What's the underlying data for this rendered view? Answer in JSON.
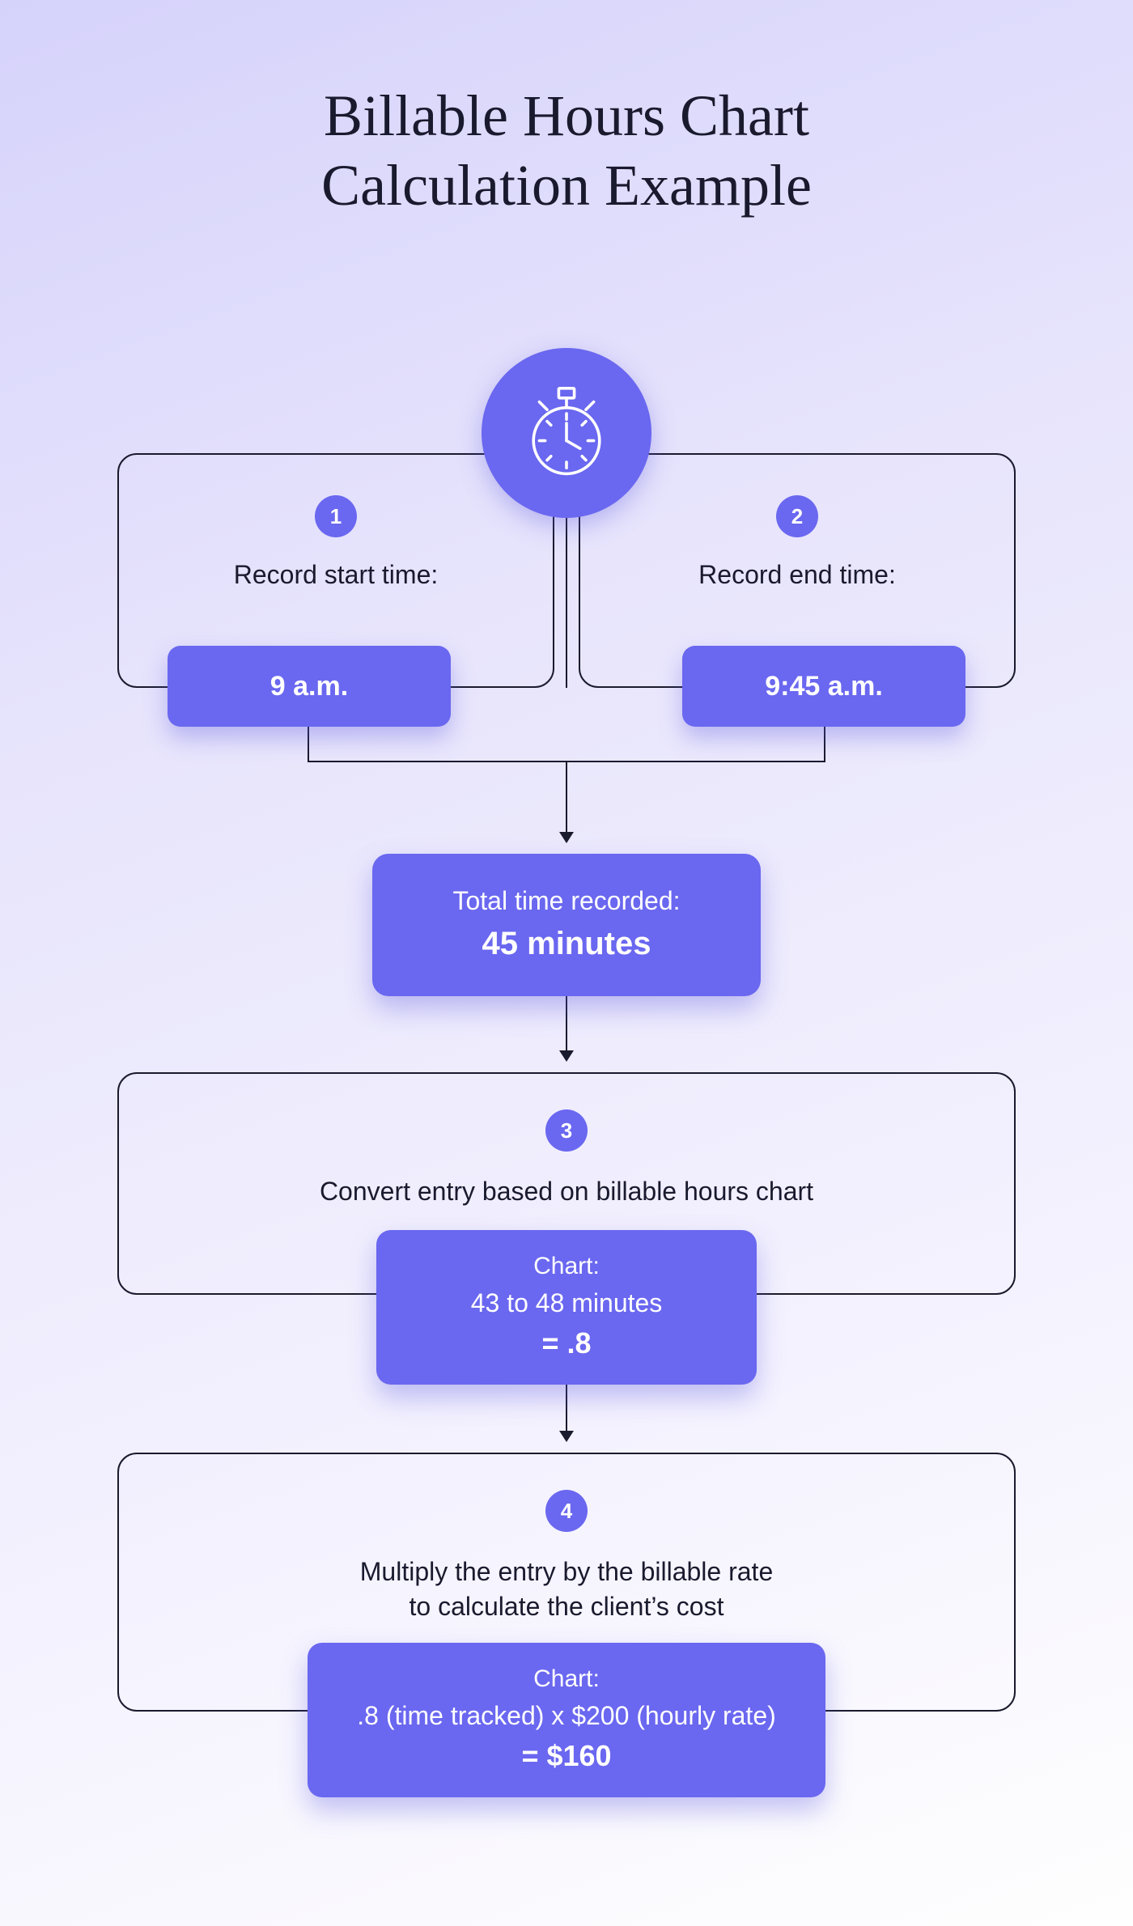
{
  "title_line1": "Billable Hours Chart",
  "title_line2": "Calculation Example",
  "icon_name": "stopwatch",
  "step1": {
    "num": "1",
    "label": "Record start time:",
    "value": "9 a.m."
  },
  "step2": {
    "num": "2",
    "label": "Record end time:",
    "value": "9:45 a.m."
  },
  "total": {
    "label": "Total time recorded:",
    "value": "45 minutes"
  },
  "step3": {
    "num": "3",
    "text": "Convert entry based on billable hours chart",
    "chip_label": "Chart:",
    "chip_line": "43 to 48 minutes",
    "chip_result": "= .8"
  },
  "step4": {
    "num": "4",
    "text_line1": "Multiply the entry by the billable rate",
    "text_line2": "to calculate the client’s cost",
    "chip_label": "Chart:",
    "chip_line": ".8 (time tracked) x $200 (hourly rate)",
    "chip_result": "= $160"
  }
}
